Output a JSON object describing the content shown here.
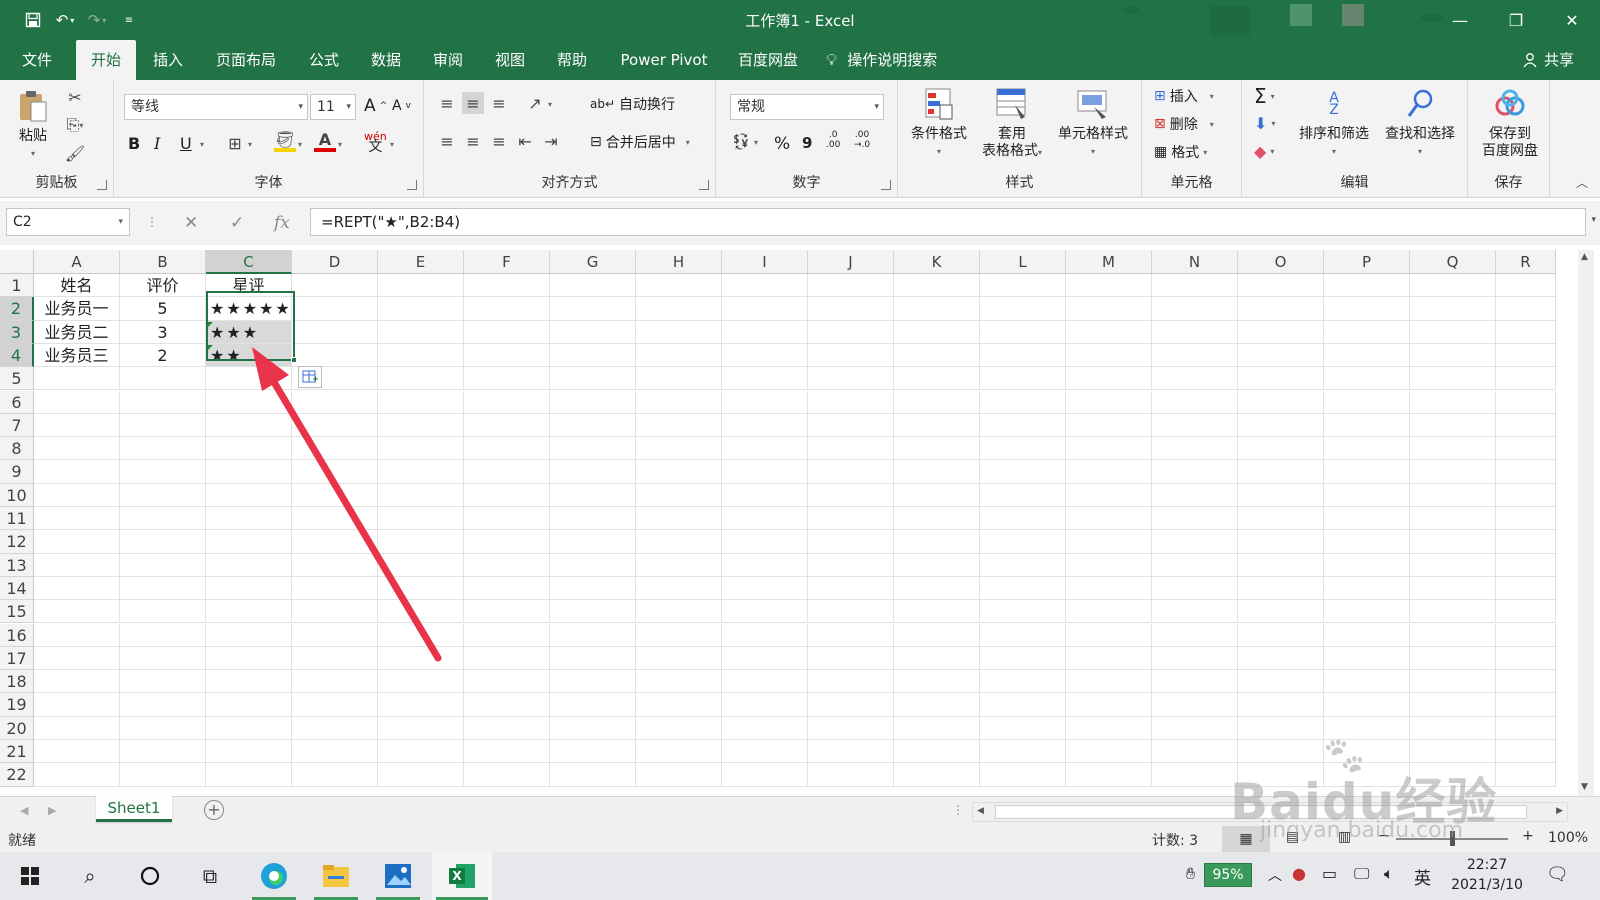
{
  "title_bar": {
    "title": "工作簿1 - Excel",
    "save_icon": "save-icon",
    "undo_icon": "undo-icon",
    "redo_icon": "redo-icon",
    "customize_icon": "customize-icon"
  },
  "menu_tabs": [
    {
      "label": "文件",
      "active": false
    },
    {
      "label": "开始",
      "active": true
    },
    {
      "label": "插入",
      "active": false
    },
    {
      "label": "页面布局",
      "active": false
    },
    {
      "label": "公式",
      "active": false
    },
    {
      "label": "数据",
      "active": false
    },
    {
      "label": "审阅",
      "active": false
    },
    {
      "label": "视图",
      "active": false
    },
    {
      "label": "帮助",
      "active": false
    },
    {
      "label": "Power Pivot",
      "active": false
    },
    {
      "label": "百度网盘",
      "active": false
    },
    {
      "label": "操作说明搜索",
      "active": false
    }
  ],
  "share_label": "共享",
  "ribbon": {
    "clipboard": {
      "paste": "粘贴",
      "group": "剪贴板"
    },
    "font": {
      "name": "等线",
      "size": "11",
      "group": "字体",
      "bold": "B",
      "italic": "I",
      "underline": "U",
      "grow": "A",
      "shrink": "A",
      "phonetic": "wén"
    },
    "alignment": {
      "wrap": "自动换行",
      "merge": "合并后居中",
      "group": "对齐方式"
    },
    "number": {
      "format": "常规",
      "percent": "%",
      "comma": "9",
      "inc_decimal_top": ".0",
      "inc_decimal_bottom": ".00",
      "dec_decimal_top": ".00",
      "dec_decimal_bottom": "→.0",
      "group": "数字"
    },
    "styles": {
      "conditional": "条件格式",
      "table_1": "套用",
      "table_2": "表格格式",
      "cell_styles": "单元格样式",
      "group": "样式"
    },
    "cells": {
      "insert": "插入",
      "delete": "删除",
      "format": "格式",
      "group": "单元格"
    },
    "editing": {
      "sort": "排序和筛选",
      "find": "查找和选择",
      "group": "编辑"
    },
    "save": {
      "label_1": "保存到",
      "label_2": "百度网盘",
      "group": "保存"
    }
  },
  "formula_bar": {
    "name_box": "C2",
    "formula": "=REPT(\"★\",B2:B4)"
  },
  "columns": [
    "A",
    "B",
    "C",
    "D",
    "E",
    "F",
    "G",
    "H",
    "I",
    "J",
    "K",
    "L",
    "M",
    "N",
    "O",
    "P",
    "Q",
    "R"
  ],
  "rows": [
    "1",
    "2",
    "3",
    "4",
    "5",
    "6",
    "7",
    "8",
    "9",
    "10",
    "11",
    "12",
    "13",
    "14",
    "15",
    "16",
    "17",
    "18",
    "19",
    "20",
    "21",
    "22"
  ],
  "cells": {
    "A1": "姓名",
    "B1": "评价",
    "C1": "星评",
    "A2": "业务员一",
    "B2": "5",
    "C2": "★★★★★",
    "A3": "业务员二",
    "B3": "3",
    "C3": "★★★",
    "A4": "业务员三",
    "B4": "2",
    "C4": "★★"
  },
  "sheet_tabs": [
    "Sheet1"
  ],
  "status": {
    "ready": "就绪",
    "count": "计数: 3",
    "zoom": "100%"
  },
  "taskbar": {
    "battery": "95%",
    "ime": "英",
    "time": "22:27",
    "date": "2021/3/10"
  },
  "watermark": {
    "line1": "Baidu经验",
    "line2": "jingyan.baidu.com"
  },
  "colors": {
    "excel_green": "#217346",
    "arrow_red": "#e8334a"
  }
}
